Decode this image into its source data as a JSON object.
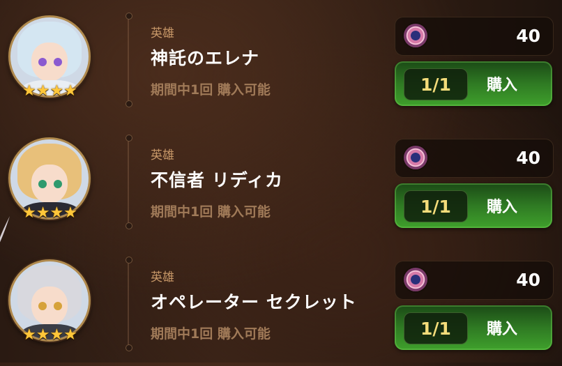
{
  "items": [
    {
      "category": "英雄",
      "name": "神託のエレナ",
      "purchase_limit": "期間中1回 購入可能",
      "stars": "★★★★",
      "star_count": 4,
      "price": "40",
      "currency_icon": "gem-coin-icon",
      "remaining": "1/1",
      "buy_label": "購入",
      "hair_color": "#d4e6f2",
      "eye_color": "#8a5ad0",
      "outfit_color": "#e9eef4"
    },
    {
      "category": "英雄",
      "name": "不信者 リディカ",
      "purchase_limit": "期間中1回 購入可能",
      "stars": "★★★★",
      "star_count": 4,
      "price": "40",
      "currency_icon": "gem-coin-icon",
      "remaining": "1/1",
      "buy_label": "購入",
      "hair_color": "#e8c07a",
      "eye_color": "#2f9a6e",
      "outfit_color": "#2a2a34"
    },
    {
      "category": "英雄",
      "name": "オペレーター セクレット",
      "purchase_limit": "期間中1回 購入可能",
      "stars": "★★★★",
      "star_count": 4,
      "price": "40",
      "currency_icon": "gem-coin-icon",
      "remaining": "1/1",
      "buy_label": "購入",
      "hair_color": "#d8d8de",
      "eye_color": "#d6a23a",
      "outfit_color": "#3a3d46"
    }
  ],
  "colors": {
    "accent_green": "#3fa02c",
    "star_gold": "#ffc73a",
    "count_text": "#f3dc7a",
    "category_text": "#c89868"
  }
}
